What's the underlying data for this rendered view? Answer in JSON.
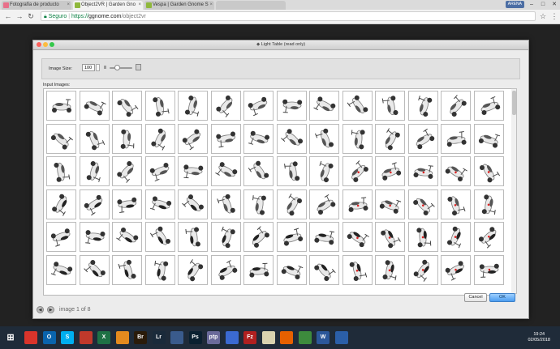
{
  "browser": {
    "tabs": [
      {
        "title": "Fotografía de producto",
        "favicon_color": "#e8708a",
        "active": false
      },
      {
        "title": "Object2VR | Garden Gno",
        "favicon_color": "#8fb83c",
        "active": true
      },
      {
        "title": "Vespa | Garden Gnome S",
        "favicon_color": "#8fb83c",
        "active": false
      },
      {
        "title": "",
        "favicon_color": "",
        "active": false
      }
    ],
    "user": "ARENA",
    "secure_label": "Seguro",
    "url_scheme": "https://",
    "url_host": "ggnome.com",
    "url_path": "/object2vr"
  },
  "page": {
    "heading": "",
    "pager_text": "image 1 of 8"
  },
  "dialog": {
    "title": "Light Table (read only)",
    "image_size_label": "Image Size:",
    "image_size_value": "100",
    "image_size_level": 0.35,
    "input_images_label": "Input Images:",
    "cancel_label": "Cancel",
    "ok_label": "OK",
    "grid": {
      "rows": 6,
      "columns": 14
    },
    "colors": {
      "close": "#fc605b",
      "minimize": "#fdbc40",
      "maximize": "#34c84a"
    }
  },
  "taskbar": {
    "time": "19:24",
    "date": "02/05/2018",
    "apps": [
      {
        "name": "chrome",
        "label": "",
        "color": "#d9342b"
      },
      {
        "name": "outlook",
        "label": "O",
        "color": "#0a64ad"
      },
      {
        "name": "skype",
        "label": "S",
        "color": "#00aff0"
      },
      {
        "name": "app-red",
        "label": "",
        "color": "#c0392b"
      },
      {
        "name": "excel",
        "label": "X",
        "color": "#1e7145"
      },
      {
        "name": "app-orange",
        "label": "",
        "color": "#e38a1e"
      },
      {
        "name": "bridge",
        "label": "Br",
        "color": "#2a1b0a"
      },
      {
        "name": "lightroom",
        "label": "Lr",
        "color": "#1a2a3a"
      },
      {
        "name": "app-blue",
        "label": "",
        "color": "#3a5b8c"
      },
      {
        "name": "photoshop",
        "label": "Ps",
        "color": "#0a2030"
      },
      {
        "name": "ptgui",
        "label": "ptp",
        "color": "#6a6a9a"
      },
      {
        "name": "mediaplayer",
        "label": "",
        "color": "#3b6ad1"
      },
      {
        "name": "filezilla",
        "label": "Fz",
        "color": "#b02020"
      },
      {
        "name": "app-pale",
        "label": "",
        "color": "#d9d3b0"
      },
      {
        "name": "firefox",
        "label": "",
        "color": "#e66000"
      },
      {
        "name": "app-green",
        "label": "",
        "color": "#3d8b3d"
      },
      {
        "name": "word",
        "label": "W",
        "color": "#2b579a"
      },
      {
        "name": "app-blue2",
        "label": "",
        "color": "#2b5fa8"
      }
    ]
  }
}
